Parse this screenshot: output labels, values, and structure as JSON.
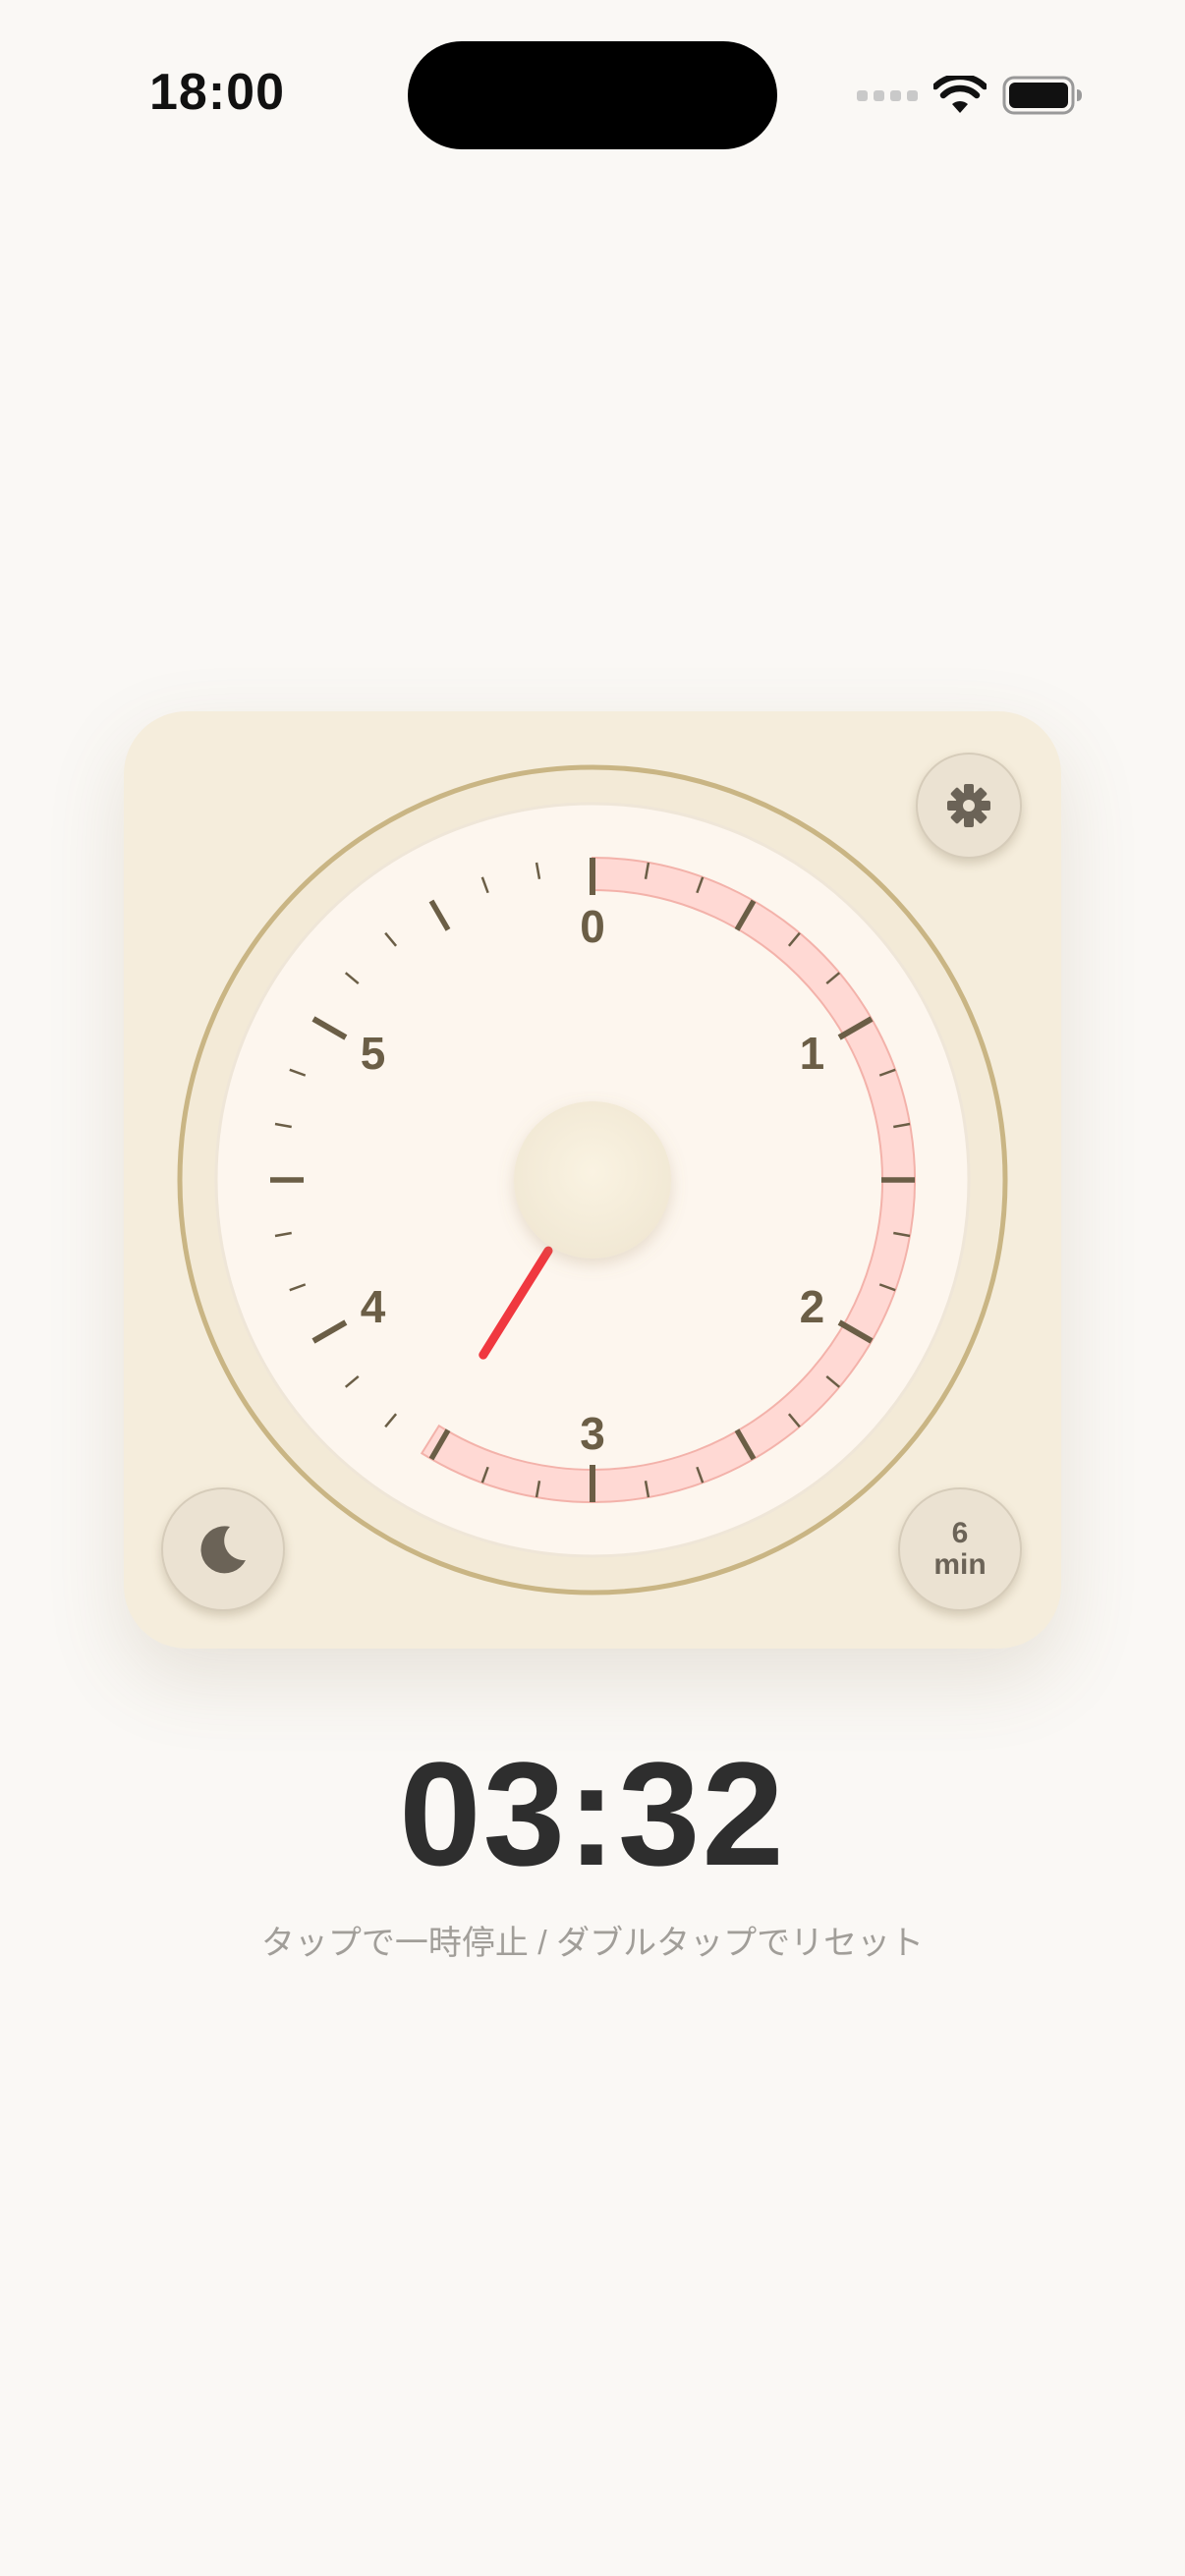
{
  "status_bar": {
    "time": "18:00",
    "icons": [
      "cellular-signal-icon",
      "wifi-icon",
      "battery-icon"
    ]
  },
  "timer": {
    "display": "03:32",
    "hint": "タップで一時停止 / ダブルタップでリセット",
    "duration": {
      "value": "6",
      "unit": "min"
    },
    "total_minutes": 6,
    "remaining_minutes": 3.533,
    "dial_labels": [
      "0",
      "1",
      "2",
      "3",
      "4",
      "5"
    ]
  },
  "controls": {
    "settings_icon": "gear-icon",
    "night_mode_icon": "moon-icon"
  },
  "colors": {
    "background": "#faf8f5",
    "card": "#f5eddc",
    "ring": "#c9b584",
    "dial_face": "#fdf6ee",
    "remaining_arc": "#ffd9d4",
    "hand": "#f0383f",
    "tick": "#6b5e46",
    "time_text": "#2e2e2e",
    "hint_text": "#a19e99"
  }
}
